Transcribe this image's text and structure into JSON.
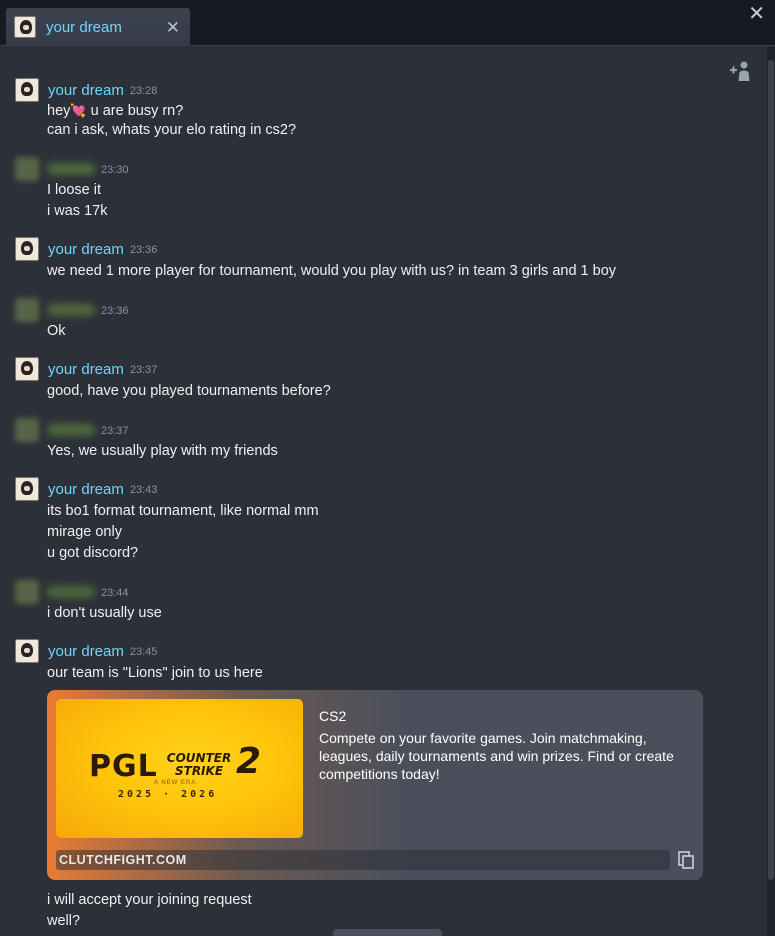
{
  "window": {
    "tab_title": "your dream",
    "tab_close": "✕",
    "window_close": "✕"
  },
  "chat": {
    "messages": [
      {
        "author": "your dream",
        "time": "23:28",
        "lines": [
          "u are busy rn?",
          "can i ask, whats your elo rating in cs2?"
        ],
        "prefix": "hey"
      },
      {
        "author": "",
        "time": "23:30",
        "lines": [
          "I loose it",
          "i was 17k"
        ]
      },
      {
        "author": "your dream",
        "time": "23:36",
        "lines": [
          "we need 1 more player for tournament, would you play with us? in team 3 girls and 1 boy"
        ]
      },
      {
        "author": "",
        "time": "23:36",
        "lines": [
          "Ok"
        ]
      },
      {
        "author": "your dream",
        "time": "23:37",
        "lines": [
          "good, have you played tournaments before?"
        ]
      },
      {
        "author": "",
        "time": "23:37",
        "lines": [
          "Yes, we usually play with my friends"
        ]
      },
      {
        "author": "your dream",
        "time": "23:43",
        "lines": [
          "its bo1 format tournament, like normal mm",
          "mirage only",
          "u got discord?"
        ]
      },
      {
        "author": "",
        "time": "23:44",
        "lines": [
          "i don't usually use"
        ]
      },
      {
        "author": "your dream",
        "time": "23:45",
        "lines": [
          "our team is \"Lions\" join to us here"
        ],
        "after_embed": [
          "i will accept your joining request",
          "well?"
        ]
      }
    ],
    "embed": {
      "title": "CS2",
      "description": "Compete on your favorite games. Join matchmaking, leagues, daily tournaments and win prizes. Find or create competitions today!",
      "domain": "CLUTCHFIGHT.COM",
      "image": {
        "brand": "PGL",
        "game_line1": "COUNTER",
        "game_line2": "STRIKE",
        "game_num": "2",
        "tagline": "A NEW ERA",
        "years": "2025 · 2026"
      }
    }
  },
  "colors": {
    "accent_name": "#6fd6ff",
    "background": "#2c3038",
    "embed_image": "#ffc50a"
  }
}
